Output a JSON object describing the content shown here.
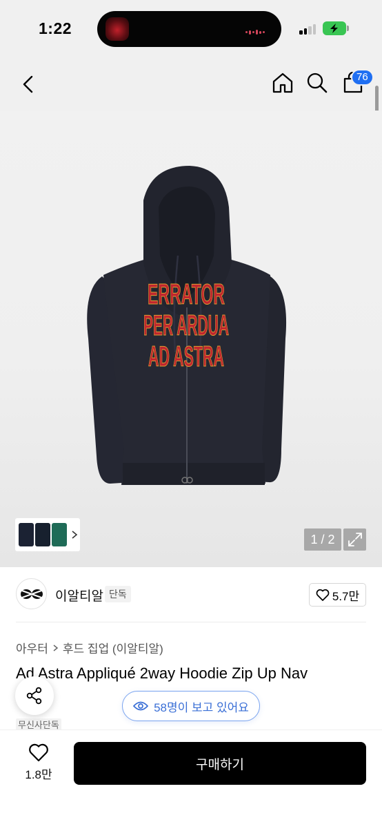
{
  "status_bar": {
    "time": "1:22"
  },
  "nav": {
    "back_icon": "chevron-left-icon",
    "home_icon": "home-icon",
    "search_icon": "search-icon",
    "cart_icon": "shopping-bag-icon",
    "cart_count": "76",
    "badge_color": "#1f6ff2"
  },
  "product_image": {
    "page_current": 1,
    "page_total": 2,
    "page_label": "1 / 2",
    "print_lines": [
      "ERRATOR",
      "PER ARDUA",
      "AD ASTRA"
    ],
    "thumbnail_colors": [
      "#1b2233",
      "#17202e",
      "#1f6b57"
    ]
  },
  "brand": {
    "name": "이알티알",
    "badge": "단독",
    "likes": "5.7만"
  },
  "product": {
    "breadcrumb": [
      "아우터",
      "후드 집업 (이알티알)"
    ],
    "title": "Ad Astra Appliqué 2way Hoodie Zip Up Nav",
    "title_cont": "-",
    "tag": "무신사단독"
  },
  "viewers": {
    "text": "58명이 보고 있어요",
    "accent": "#3a6fd6"
  },
  "bottom": {
    "wish_count": "1.8만",
    "buy_label": "구매하기"
  }
}
